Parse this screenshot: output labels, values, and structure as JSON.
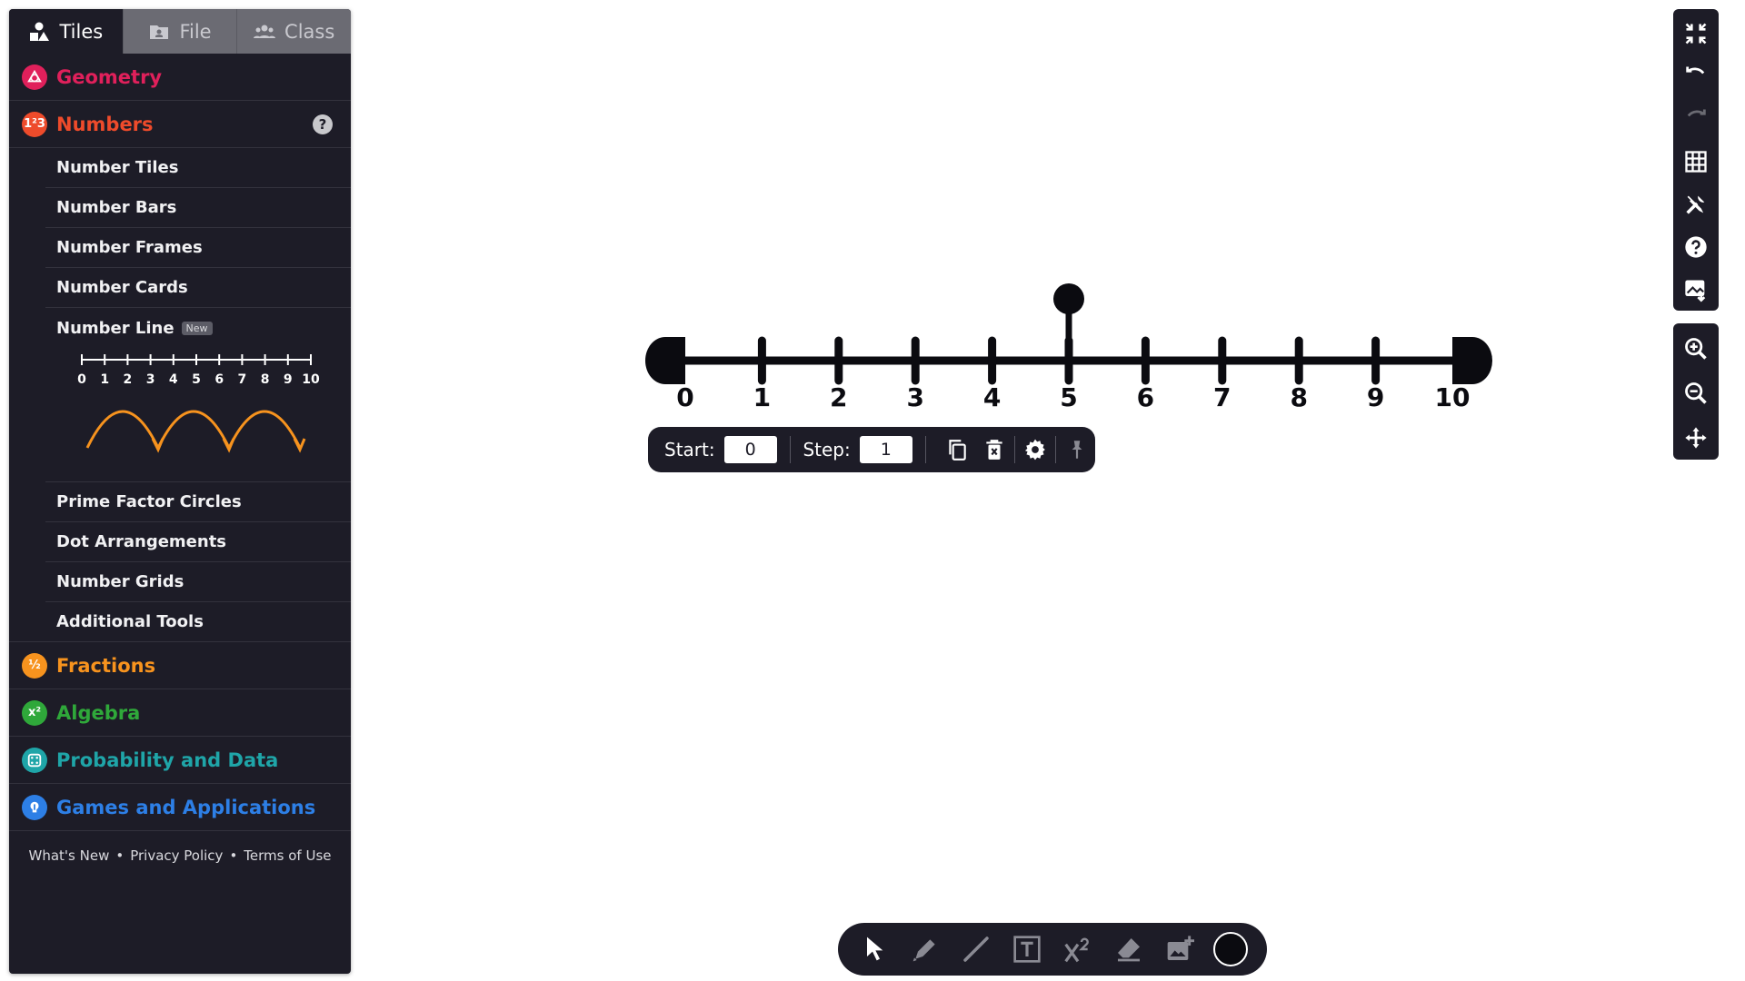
{
  "tabs": [
    {
      "label": "Tiles",
      "icon": "shapes-icon",
      "active": true
    },
    {
      "label": "File",
      "icon": "folder-icon",
      "active": false
    },
    {
      "label": "Class",
      "icon": "users-icon",
      "active": false
    }
  ],
  "categories": {
    "geometry": {
      "label": "Geometry",
      "color": "#e0205b"
    },
    "numbers": {
      "label": "Numbers",
      "color": "#ee4b2b",
      "icon_text": "1²3"
    },
    "fractions": {
      "label": "Fractions",
      "color": "#f7931e",
      "icon_text": "½"
    },
    "algebra": {
      "label": "Algebra",
      "color": "#2fa83a",
      "icon_text": "x²"
    },
    "probability": {
      "label": "Probability and Data",
      "color": "#1fa5a8"
    },
    "games": {
      "label": "Games and Applications",
      "color": "#2d7fe6"
    }
  },
  "numbers_items": [
    "Number Tiles",
    "Number Bars",
    "Number Frames",
    "Number Cards",
    "Number Line",
    "Prime Factor Circles",
    "Dot Arrangements",
    "Number Grids",
    "Additional Tools"
  ],
  "new_badge": "New",
  "preview_labels": [
    "0",
    "1",
    "2",
    "3",
    "4",
    "5",
    "6",
    "7",
    "8",
    "9",
    "10"
  ],
  "footer": {
    "whats_new": "What's New",
    "privacy": "Privacy Policy",
    "terms": "Terms of Use"
  },
  "number_line": {
    "start": 0,
    "step": 1,
    "end": 10,
    "marker_value": 5,
    "labels": [
      "0",
      "1",
      "2",
      "3",
      "4",
      "5",
      "6",
      "7",
      "8",
      "9",
      "10"
    ]
  },
  "nl_toolbar": {
    "start_label": "Start:",
    "start_value": "0",
    "step_label": "Step:",
    "step_value": "1"
  },
  "colors": {
    "panel_bg": "#1d1c27",
    "arc_orange": "#f7931e",
    "line_black": "#0b0b10"
  }
}
